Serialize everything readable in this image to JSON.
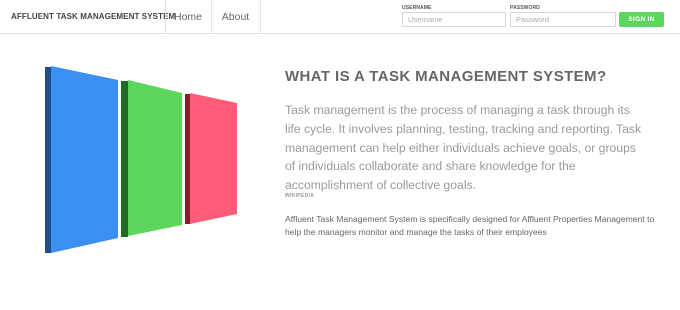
{
  "navbar": {
    "brand": "AFFLUENT TASK MANAGEMENT SYSTEM",
    "links": [
      {
        "label": "Home"
      },
      {
        "label": "About"
      }
    ],
    "login": {
      "username_label": "USERNAME",
      "username_placeholder": "Username",
      "username_value": "",
      "password_label": "PASSWORD",
      "password_placeholder": "Password",
      "password_value": "",
      "signin_label": "SIGN IN"
    }
  },
  "hero": {
    "graphic_colors": [
      "#3a8ff0",
      "#5cd65c",
      "#ff5c7a"
    ],
    "heading": "WHAT IS A TASK MANAGEMENT SYSTEM?",
    "lead": "Task management is the process of managing a task through its life cycle. It involves planning, testing, tracking and reporting. Task management can help either individuals achieve goals, or groups of individuals collaborate and share knowledge for the accomplishment of collective goals.",
    "source": "WIKIPEDIA",
    "description": "Affluent Task Management System is specifically designed for Affluent Properties Management to help the managers monitor and manage the tasks of their employees"
  }
}
